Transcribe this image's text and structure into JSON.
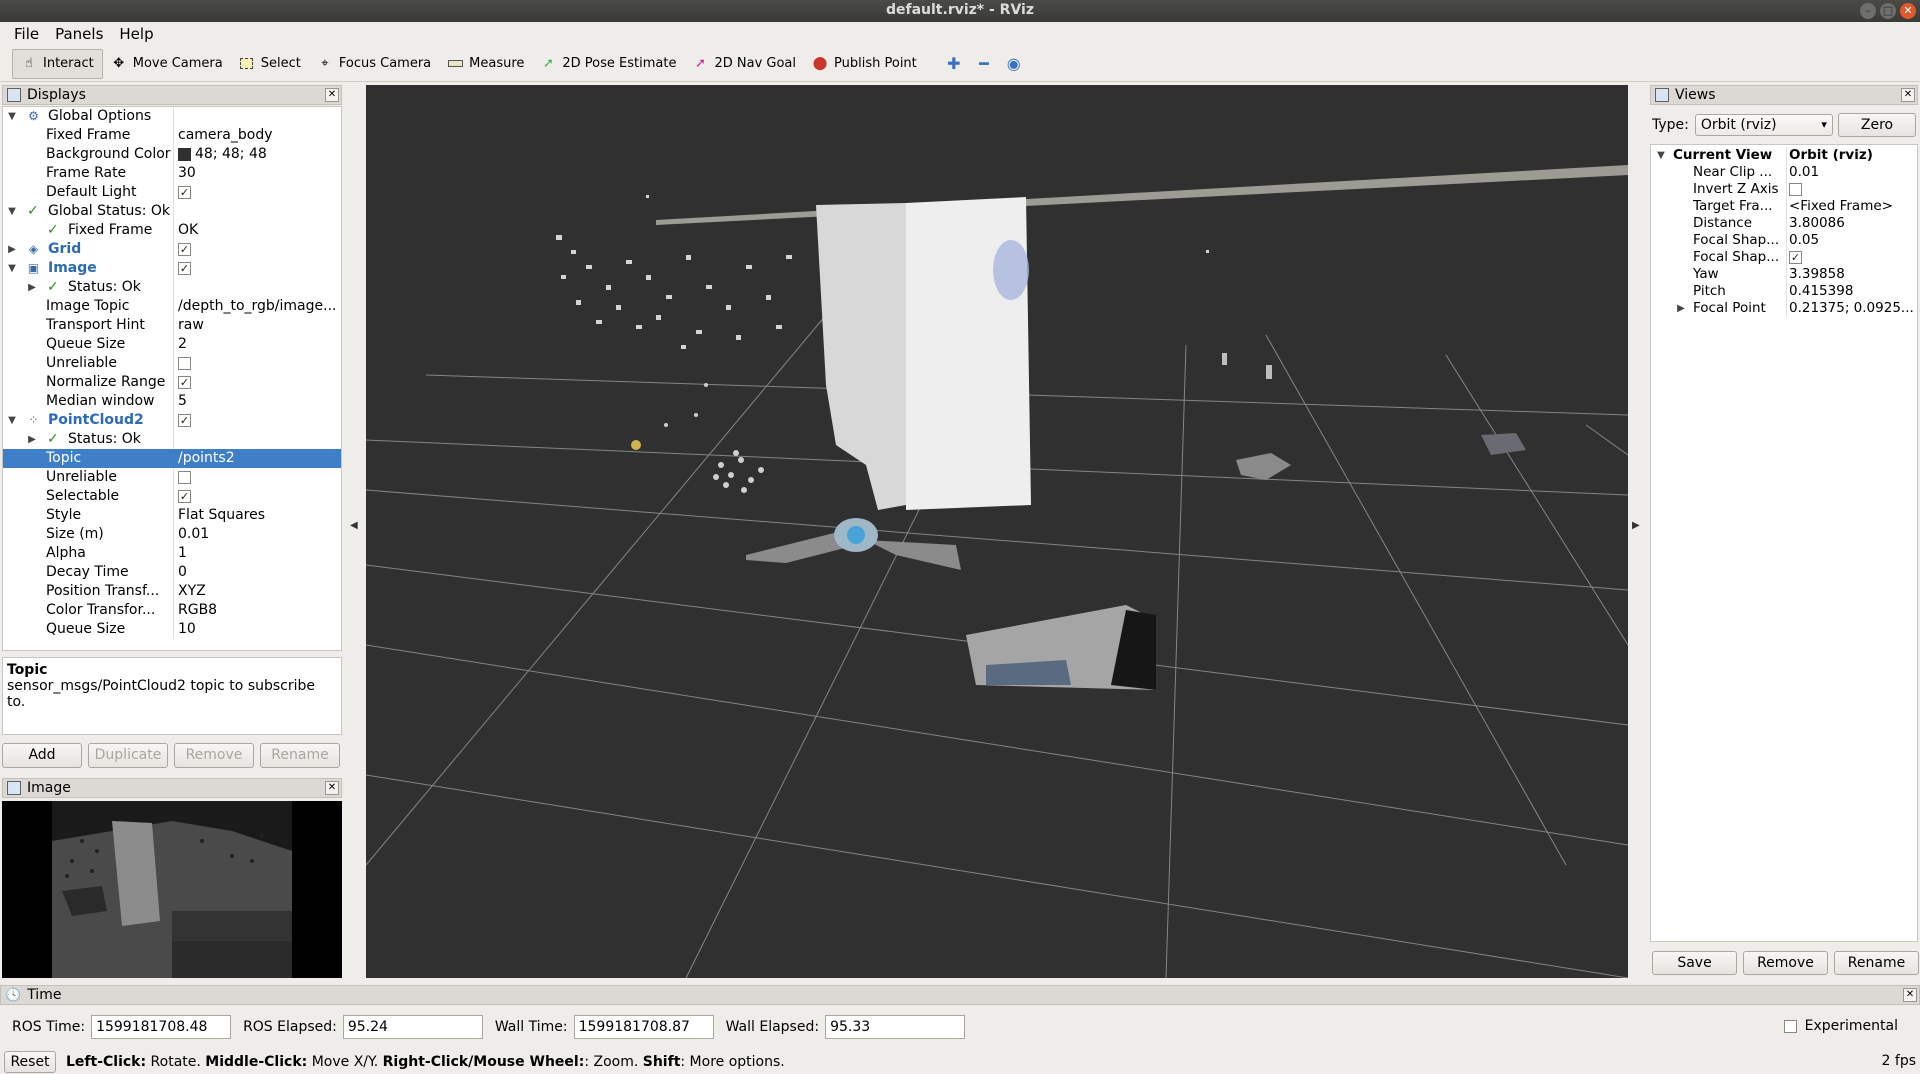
{
  "window": {
    "title": "default.rviz* - RViz"
  },
  "menu": [
    "File",
    "Panels",
    "Help"
  ],
  "toolbar": {
    "tools": [
      {
        "label": "Interact",
        "icon": "interact-icon"
      },
      {
        "label": "Move Camera",
        "icon": "move-camera-icon"
      },
      {
        "label": "Select",
        "icon": "select-icon"
      },
      {
        "label": "Focus Camera",
        "icon": "focus-camera-icon"
      },
      {
        "label": "Measure",
        "icon": "measure-icon"
      },
      {
        "label": "2D Pose Estimate",
        "icon": "pose-arrow-icon"
      },
      {
        "label": "2D Nav Goal",
        "icon": "nav-goal-arrow-icon"
      },
      {
        "label": "Publish Point",
        "icon": "map-pin-icon"
      }
    ]
  },
  "displays": {
    "title": "Displays",
    "rows": [
      {
        "k": "Global Options",
        "v": ""
      },
      {
        "k": "Fixed Frame",
        "v": "camera_body"
      },
      {
        "k": "Background Color",
        "v": "48; 48; 48"
      },
      {
        "k": "Frame Rate",
        "v": "30"
      },
      {
        "k": "Default Light",
        "v": ""
      },
      {
        "k": "Global Status: Ok",
        "v": ""
      },
      {
        "k": "Fixed Frame",
        "v": "OK"
      },
      {
        "k": "Grid",
        "v": ""
      },
      {
        "k": "Image",
        "v": ""
      },
      {
        "k": "Status: Ok",
        "v": ""
      },
      {
        "k": "Image Topic",
        "v": "/depth_to_rgb/image..."
      },
      {
        "k": "Transport Hint",
        "v": "raw"
      },
      {
        "k": "Queue Size",
        "v": "2"
      },
      {
        "k": "Unreliable",
        "v": ""
      },
      {
        "k": "Normalize Range",
        "v": ""
      },
      {
        "k": "Median window",
        "v": "5"
      },
      {
        "k": "PointCloud2",
        "v": ""
      },
      {
        "k": "Status: Ok",
        "v": ""
      },
      {
        "k": "Topic",
        "v": "/points2"
      },
      {
        "k": "Unreliable",
        "v": ""
      },
      {
        "k": "Selectable",
        "v": ""
      },
      {
        "k": "Style",
        "v": "Flat Squares"
      },
      {
        "k": "Size (m)",
        "v": "0.01"
      },
      {
        "k": "Alpha",
        "v": "1"
      },
      {
        "k": "Decay Time",
        "v": "0"
      },
      {
        "k": "Position Transf...",
        "v": "XYZ"
      },
      {
        "k": "Color Transfor...",
        "v": "RGB8"
      },
      {
        "k": "Queue Size",
        "v": "10"
      }
    ]
  },
  "description": {
    "heading": "Topic",
    "text": "sensor_msgs/PointCloud2 topic to subscribe to."
  },
  "display_buttons": {
    "add": "Add",
    "duplicate": "Duplicate",
    "remove": "Remove",
    "rename": "Rename"
  },
  "image_panel": {
    "title": "Image"
  },
  "views": {
    "title": "Views",
    "type_label": "Type:",
    "type_value": "Orbit (rviz)",
    "zero": "Zero",
    "rows": [
      {
        "k": "Current View",
        "v": "Orbit (rviz)"
      },
      {
        "k": "Near Clip ...",
        "v": "0.01"
      },
      {
        "k": "Invert Z Axis",
        "v": ""
      },
      {
        "k": "Target Fra...",
        "v": "<Fixed Frame>"
      },
      {
        "k": "Distance",
        "v": "3.80086"
      },
      {
        "k": "Focal Shap...",
        "v": "0.05"
      },
      {
        "k": "Focal Shap...",
        "v": ""
      },
      {
        "k": "Yaw",
        "v": "3.39858"
      },
      {
        "k": "Pitch",
        "v": "0.415398"
      },
      {
        "k": "Focal Point",
        "v": "0.21375; 0.0925..."
      }
    ],
    "save": "Save",
    "remove": "Remove",
    "rename": "Rename"
  },
  "time": {
    "title": "Time",
    "ros_time_label": "ROS Time:",
    "ros_time": "1599181708.48",
    "ros_elapsed_label": "ROS Elapsed:",
    "ros_elapsed": "95.24",
    "wall_time_label": "Wall Time:",
    "wall_time": "1599181708.87",
    "wall_elapsed_label": "Wall Elapsed:",
    "wall_elapsed": "95.33",
    "experimental": "Experimental"
  },
  "status": {
    "reset": "Reset",
    "b1": "Left-Click:",
    "t1": " Rotate. ",
    "b2": "Middle-Click:",
    "t2": " Move X/Y. ",
    "b3": "Right-Click/Mouse Wheel:",
    "t3": ": Zoom. ",
    "b4": "Shift",
    "t4": ": More options.",
    "fps": "2 fps"
  },
  "colors": {
    "viewport_bg": "#303030",
    "selection": "#3e7fc8",
    "status_ok": "#2e8b2e"
  }
}
